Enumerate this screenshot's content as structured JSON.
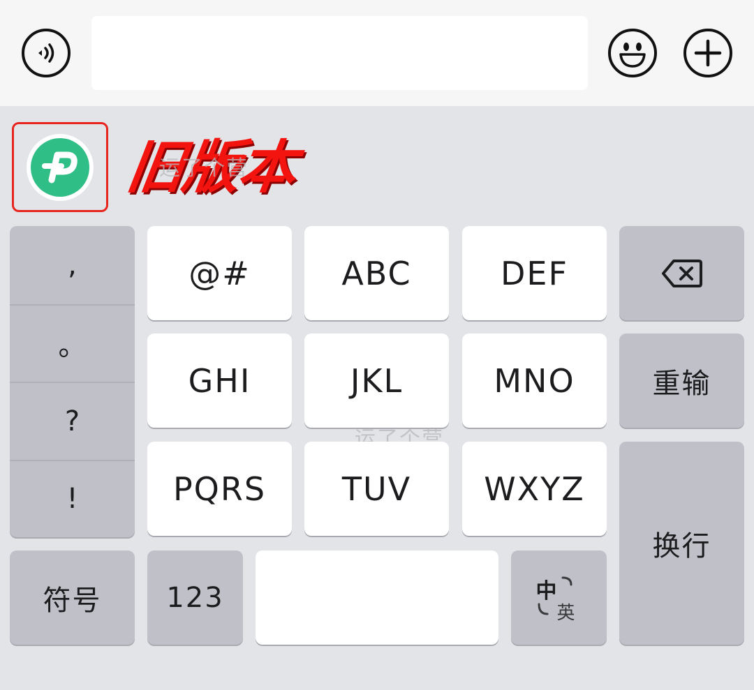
{
  "top_bar": {
    "input_value": "",
    "voice_icon": "voice-input-icon",
    "emoji_icon": "emoji-icon",
    "plus_icon": "plus-icon"
  },
  "toolbar": {
    "app_logo_letter": "P",
    "annotation": "旧版本",
    "annotation_color": "#f3140f",
    "highlight_color": "#e8241f",
    "logo_color": "#2fbf86"
  },
  "watermark": "运了个营",
  "keyboard": {
    "punctuation": [
      ",",
      "。",
      "?",
      "!"
    ],
    "rows": [
      [
        "@#",
        "ABC",
        "DEF"
      ],
      [
        "GHI",
        "JKL",
        "MNO"
      ],
      [
        "PQRS",
        "TUV",
        "WXYZ"
      ]
    ],
    "backspace_icon": "backspace-icon",
    "retype": "重输",
    "newline": "换行",
    "symbols": "符号",
    "numbers": "123",
    "space": "",
    "lang_zh": "中",
    "lang_en": "英"
  }
}
